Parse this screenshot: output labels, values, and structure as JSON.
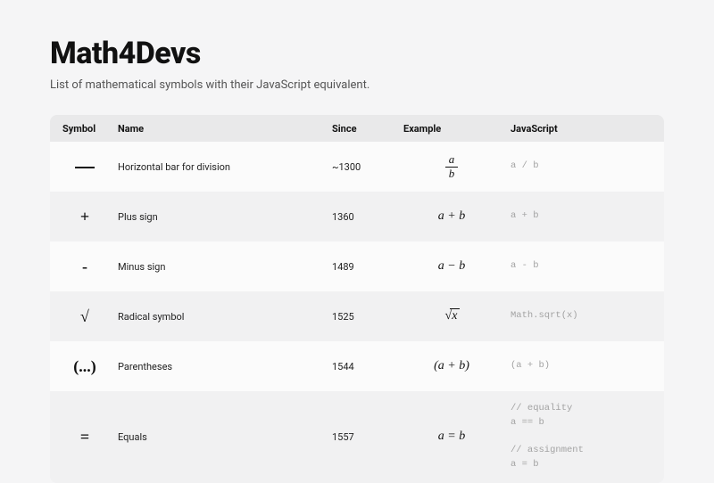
{
  "header": {
    "title": "Math4Devs",
    "subtitle": "List of mathematical symbols with their JavaScript equivalent."
  },
  "table": {
    "columns": {
      "symbol": "Symbol",
      "name": "Name",
      "since": "Since",
      "example": "Example",
      "js": "JavaScript"
    },
    "rows": [
      {
        "symbol_type": "hbar",
        "symbol": "—",
        "name": "Horizontal bar for division",
        "since": "~1300",
        "example_type": "frac",
        "example_num": "a",
        "example_den": "b",
        "js": "a / b"
      },
      {
        "symbol_type": "text",
        "symbol": "+",
        "name": "Plus sign",
        "since": "1360",
        "example_type": "binary",
        "example_text": "a + b",
        "js": "a + b"
      },
      {
        "symbol_type": "text",
        "symbol": "-",
        "name": "Minus sign",
        "since": "1489",
        "example_type": "binary",
        "example_text": "a − b",
        "js": "a - b"
      },
      {
        "symbol_type": "text",
        "symbol": "√",
        "name": "Radical symbol",
        "since": "1525",
        "example_type": "sqrt",
        "example_radicand": "x",
        "js": "Math.sqrt(x)"
      },
      {
        "symbol_type": "text",
        "symbol": "(...)",
        "name": "Parentheses",
        "since": "1544",
        "example_type": "binary",
        "example_text": "(a + b)",
        "js": "(a + b)"
      },
      {
        "symbol_type": "text",
        "symbol": "=",
        "name": "Equals",
        "since": "1557",
        "example_type": "binary",
        "example_text": "a = b",
        "js": "// equality\na == b\n\n// assignment\na = b"
      }
    ]
  }
}
